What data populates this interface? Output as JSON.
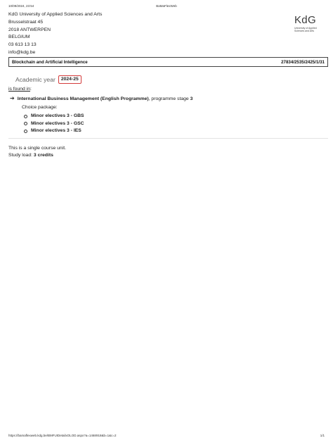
{
  "print_header": {
    "datetime": "10/09/2024, 23:54",
    "title": "BaMaFlexWeb"
  },
  "address": {
    "lines": [
      "KdG University of Applied Sciences and Arts",
      "Brusselstraat 45",
      "2018 ANTWERPEN",
      "BELGIUM",
      "03 613 13 13",
      "info@kdg.be"
    ]
  },
  "logo": {
    "text": "KdG",
    "subtitle_lines": [
      "University of Applied",
      "Sciences and Arts"
    ]
  },
  "course": {
    "name": "Blockchain and Artificial Intelligence",
    "code": "27834/2535/2425/1/31"
  },
  "academic_year": {
    "label": "Academic year",
    "value": "2024-25"
  },
  "found_in_label": "is found in",
  "found_in_colon": ":",
  "programme": {
    "arrow": "➔",
    "name": "International Business Management (English Programme)",
    "stage_text": ", programme stage ",
    "stage": "3"
  },
  "choice_package_label": "Choice package:",
  "electives": [
    "Minor electives 3 - GBS",
    "Minor electives 3 - GSC",
    "Minor electives 3 - IES"
  ],
  "unit_text": "This is a single course unit.",
  "study_load": {
    "label": "Study load: ",
    "value": "3 credits"
  },
  "footer": {
    "url": "https://bamaflexweb.kdg.be/BMFUIDetailxOLOD.aspx?a=1468918&b=1&c=2",
    "page": "1/1"
  }
}
